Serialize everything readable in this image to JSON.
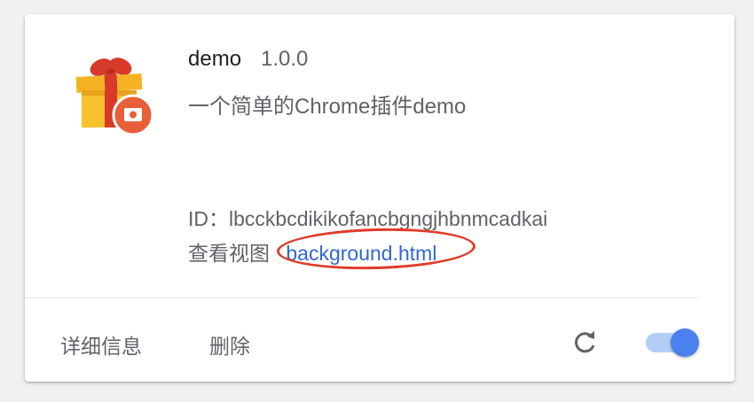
{
  "extension": {
    "name": "demo",
    "version": "1.0.0",
    "description": "一个简单的Chrome插件demo",
    "id_label": "ID：",
    "id_value": "lbcckbcdikikofancbgngjhbnmcadkai",
    "views_label": "查看视图",
    "views_link": "background.html",
    "enabled": true
  },
  "actions": {
    "details_label": "详细信息",
    "remove_label": "删除"
  },
  "icons": {
    "extension": "gift-icon",
    "badge": "camera-badge-icon",
    "reload": "reload-icon"
  },
  "colors": {
    "link": "#3367d6",
    "annotation": "#e03b2a",
    "toggle_on": "#4a80f0"
  }
}
